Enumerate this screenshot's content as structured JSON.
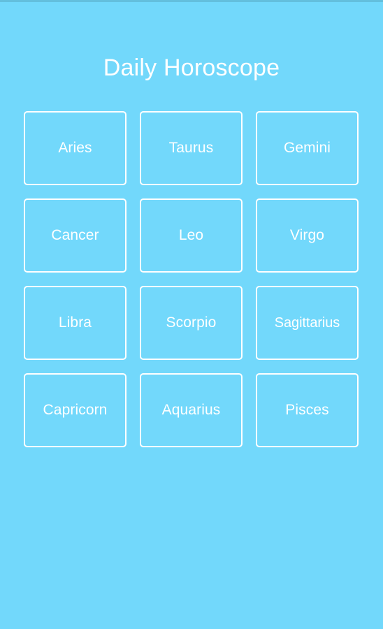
{
  "app": {
    "background_color": "#72d8fb",
    "status_bar_color": "#63bfdd",
    "accent_color": "#ffffff",
    "title": "Daily Horoscope"
  },
  "grid": {
    "columns": 3,
    "tiles": [
      {
        "label": "Aries"
      },
      {
        "label": "Taurus"
      },
      {
        "label": "Gemini"
      },
      {
        "label": "Cancer"
      },
      {
        "label": "Leo"
      },
      {
        "label": "Virgo"
      },
      {
        "label": "Libra"
      },
      {
        "label": "Scorpio"
      },
      {
        "label": "Sagittarius"
      },
      {
        "label": "Capricorn"
      },
      {
        "label": "Aquarius"
      },
      {
        "label": "Pisces"
      }
    ]
  }
}
